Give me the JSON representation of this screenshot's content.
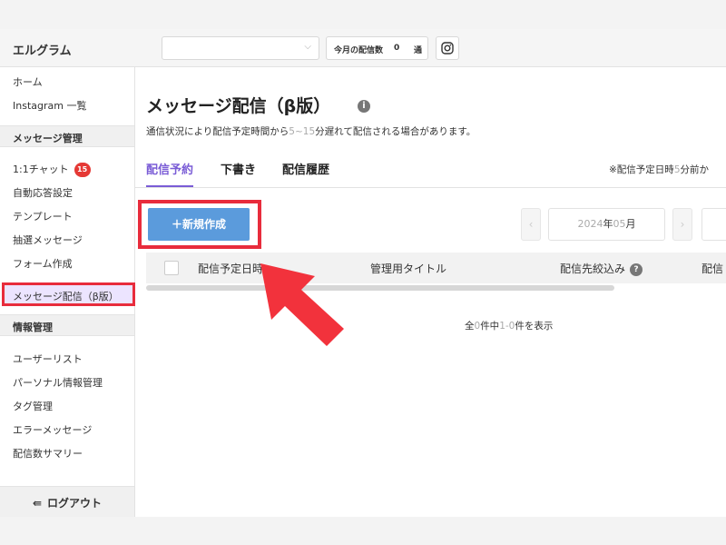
{
  "app": {
    "title": "エルグラム"
  },
  "topbar": {
    "counter_label": "今月の配信数",
    "counter_value": "0",
    "counter_unit": "通"
  },
  "sidebar": {
    "home": "ホーム",
    "instagram_list": "Instagram 一覧",
    "section_message": "メッセージ管理",
    "chat": "1:1チャット",
    "chat_badge": "15",
    "auto_reply": "自動応答設定",
    "template": "テンプレート",
    "lottery": "抽選メッセージ",
    "form": "フォーム作成",
    "broadcast_active": "メッセージ配信（β版）",
    "section_info": "情報管理",
    "user_list": "ユーザーリスト",
    "personal_info": "パーソナル情報管理",
    "tag": "タグ管理",
    "error_message": "エラーメッセージ",
    "summary": "配信数サマリー",
    "logout": "ログアウト"
  },
  "main": {
    "title": "メッセージ配信（β版）",
    "notice_pre": "通信状況により配信予定時間から",
    "notice_range": "5~15",
    "notice_post": "分遅れて配信される場合があります。",
    "tabs": [
      "配信予約",
      "下書き",
      "配信履歴"
    ],
    "tab_note_pre": "※配信予定日時",
    "tab_note_num": "5",
    "tab_note_post": "分前か",
    "new_button": "＋新規作成",
    "month_year": "2024",
    "month_year_suffix": "年",
    "month_month": "05",
    "month_month_suffix": "月",
    "columns": [
      "配信予定日時",
      "管理用タイトル",
      "配信先絞込み",
      "配信"
    ],
    "count_pre": "全",
    "count_total": "0",
    "count_mid": "件中",
    "count_range": "1-0",
    "count_post": "件を表示"
  },
  "colors": {
    "accent": "#7a5cd6",
    "primary_button": "#5b9bdc",
    "highlight_red": "#e82c3c",
    "badge_red": "#e53935",
    "active_bg": "#ece4ff"
  },
  "icons": {
    "select_chevron": "chevron-down-icon",
    "instagram": "instagram-icon",
    "info": "info-icon",
    "help": "question-icon",
    "logout": "logout-icon",
    "arrow": "red-pointer-arrow"
  }
}
